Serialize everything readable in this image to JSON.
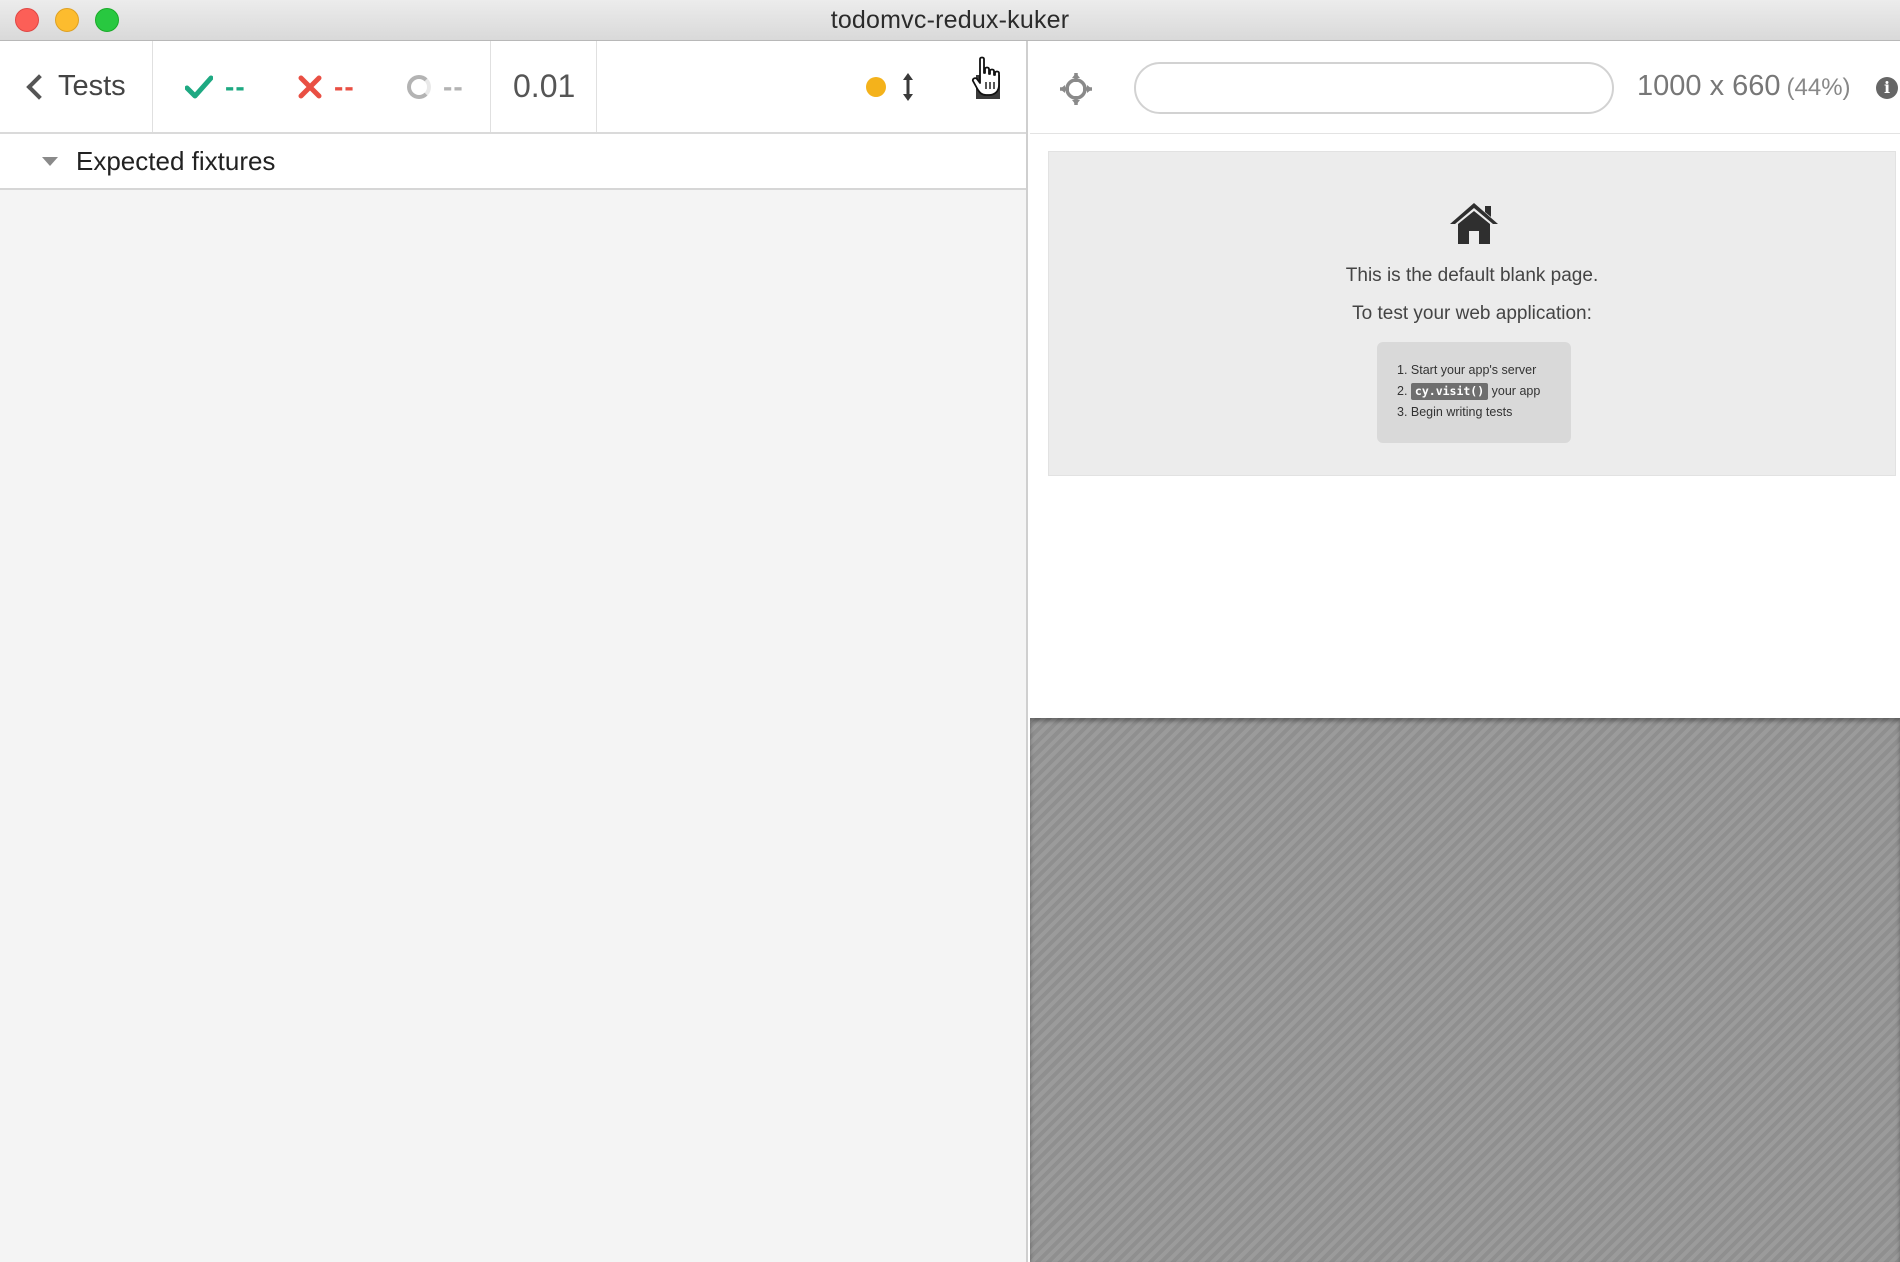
{
  "window": {
    "title": "todomvc-redux-kuker"
  },
  "reporter": {
    "back_label": "Tests",
    "passed": "--",
    "failed": "--",
    "pending": "--",
    "duration": "0.01",
    "suite_title": "Expected fixtures"
  },
  "aut": {
    "url_value": "",
    "viewport_size": "1000 x 660",
    "viewport_scale": "(44%)",
    "info_glyph": "i",
    "blank_page": {
      "line1": "This is the default blank page.",
      "line2": "To test your web application:",
      "step1": "1. Start your app's server",
      "step2_prefix": "2.",
      "step2_code": "cy.visit()",
      "step2_suffix": "your app",
      "step3": "3. Begin writing tests"
    }
  },
  "colors": {
    "passed": "#1ea982",
    "failed": "#e94f43",
    "pending": "#b3b3b3",
    "running_dot": "#f4b21b"
  },
  "icons": [
    "close-window-icon",
    "minimize-window-icon",
    "maximize-window-icon",
    "chevron-left-icon",
    "check-icon",
    "x-icon",
    "pending-ring-icon",
    "running-dot-icon",
    "scroll-toggle-icon",
    "stop-icon",
    "hand-cursor-icon",
    "caret-down-icon",
    "crosshair-icon",
    "info-icon",
    "home-icon"
  ]
}
